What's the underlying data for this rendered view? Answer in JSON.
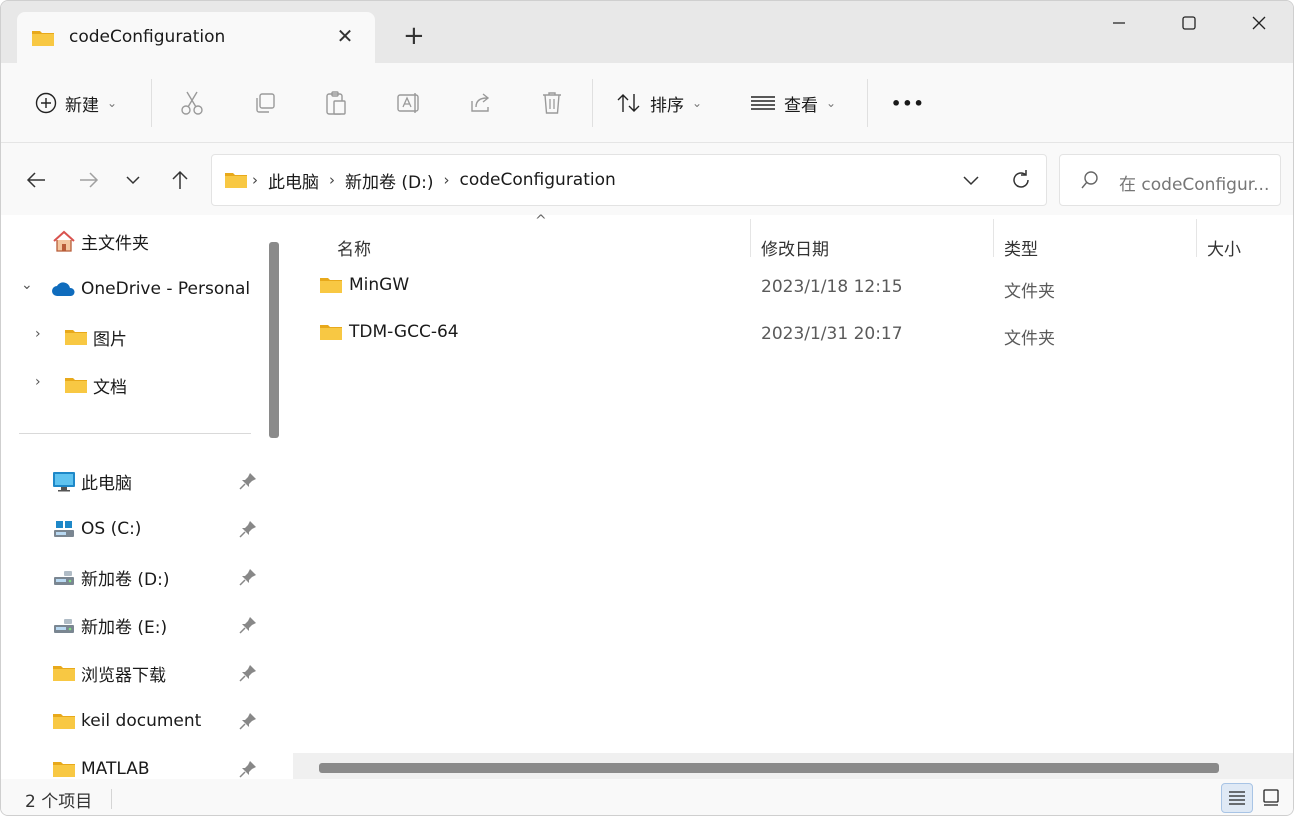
{
  "window": {
    "tab_title": "codeConfiguration",
    "new_tab_glyph": "+",
    "close_tab_glyph": "✕"
  },
  "toolbar": {
    "new_label": "新建",
    "sort_label": "排序",
    "view_label": "查看",
    "more_glyph": "•••",
    "icons": [
      "plus-circle-icon",
      "cut-icon",
      "copy-icon",
      "paste-icon",
      "rename-icon",
      "share-icon",
      "delete-icon",
      "sort-icon",
      "view-icon",
      "more-icon"
    ]
  },
  "address": {
    "crumbs": [
      "此电脑",
      "新加卷 (D:)",
      "codeConfiguration"
    ],
    "search_placeholder": "在 codeConfigur..."
  },
  "sidebar": {
    "items": [
      {
        "label": "主文件夹",
        "icon": "home-icon"
      },
      {
        "label": "OneDrive - Personal",
        "icon": "cloud-icon"
      },
      {
        "label": "图片",
        "icon": "folder-icon"
      },
      {
        "label": "文档",
        "icon": "folder-icon"
      },
      {
        "label": "此电脑",
        "icon": "monitor-icon"
      },
      {
        "label": "OS (C:)",
        "icon": "drive-icon"
      },
      {
        "label": "新加卷 (D:)",
        "icon": "drive-icon"
      },
      {
        "label": "新加卷 (E:)",
        "icon": "drive-icon"
      },
      {
        "label": "浏览器下载",
        "icon": "folder-icon"
      },
      {
        "label": "keil document",
        "icon": "folder-icon"
      },
      {
        "label": "MATLAB",
        "icon": "folder-icon"
      }
    ]
  },
  "columns": {
    "name": "名称",
    "modified": "修改日期",
    "type": "类型",
    "size": "大小"
  },
  "files": [
    {
      "name": "MinGW",
      "modified": "2023/1/18 12:15",
      "type": "文件夹"
    },
    {
      "name": "TDM-GCC-64",
      "modified": "2023/1/31 20:17",
      "type": "文件夹"
    }
  ],
  "status": {
    "count_text": "2 个项目"
  },
  "colors": {
    "folder": "#f8c843",
    "folder_dark": "#e8a91b",
    "accent": "#0067c0",
    "onedrive": "#0f6cbd"
  }
}
